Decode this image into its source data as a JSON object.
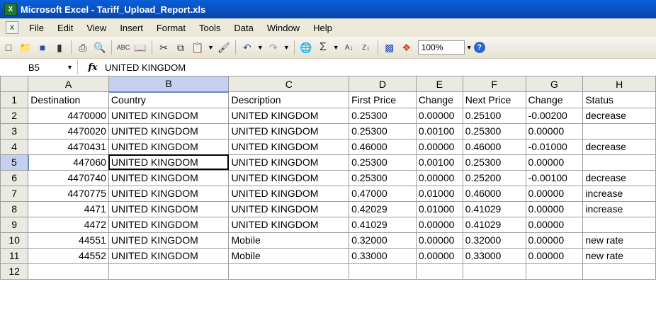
{
  "window": {
    "title": "Microsoft Excel - Tariff_Upload_Report.xls",
    "app_icon_text": "X",
    "doc_icon_text": "X"
  },
  "menu": [
    "File",
    "Edit",
    "View",
    "Insert",
    "Format",
    "Tools",
    "Data",
    "Window",
    "Help"
  ],
  "toolbar": {
    "icons": [
      "new-icon",
      "open-icon",
      "save-icon",
      "permission-icon",
      "print-icon",
      "print-preview-icon",
      "spelling-icon",
      "research-icon",
      "cut-icon",
      "copy-icon",
      "paste-icon",
      "format-painter-icon",
      "undo-icon",
      "redo-icon",
      "hyperlink-icon",
      "autosum-icon",
      "sort-ascending-icon",
      "sort-descending-icon",
      "chart-wizard-icon",
      "drawing-icon",
      "help-icon"
    ],
    "zoom": "100%",
    "help_glyph": "?"
  },
  "formula_bar": {
    "cell_ref": "B5",
    "fx": "fx",
    "value": "UNITED KINGDOM"
  },
  "grid": {
    "columns": [
      "A",
      "B",
      "C",
      "D",
      "E",
      "F",
      "G",
      "H"
    ],
    "selected_column": "B",
    "selected_row": "5",
    "rows": [
      {
        "n": "1",
        "cells": [
          "Destination",
          "Country",
          "Description",
          "First Price",
          "Change",
          "Next Price",
          "Change",
          "Status"
        ]
      },
      {
        "n": "2",
        "cells": [
          "4470000",
          "UNITED KINGDOM",
          "UNITED KINGDOM",
          "0.25300",
          "0.00000",
          "0.25100",
          "-0.00200",
          "decrease"
        ]
      },
      {
        "n": "3",
        "cells": [
          "4470020",
          "UNITED KINGDOM",
          "UNITED KINGDOM",
          "0.25300",
          "0.00100",
          "0.25300",
          "0.00000",
          ""
        ]
      },
      {
        "n": "4",
        "cells": [
          "4470431",
          "UNITED KINGDOM",
          "UNITED KINGDOM",
          "0.46000",
          "0.00000",
          "0.46000",
          "-0.01000",
          "decrease"
        ]
      },
      {
        "n": "5",
        "cells": [
          "447060",
          "UNITED KINGDOM",
          "UNITED KINGDOM",
          "0.25300",
          "0.00100",
          "0.25300",
          "0.00000",
          ""
        ]
      },
      {
        "n": "6",
        "cells": [
          "4470740",
          "UNITED KINGDOM",
          "UNITED KINGDOM",
          "0.25300",
          "0.00000",
          "0.25200",
          "-0.00100",
          "decrease"
        ]
      },
      {
        "n": "7",
        "cells": [
          "4470775",
          "UNITED KINGDOM",
          "UNITED KINGDOM",
          "0.47000",
          "0.01000",
          "0.46000",
          "0.00000",
          "increase"
        ]
      },
      {
        "n": "8",
        "cells": [
          "4471",
          "UNITED KINGDOM",
          "UNITED KINGDOM",
          "0.42029",
          "0.01000",
          "0.41029",
          "0.00000",
          "increase"
        ]
      },
      {
        "n": "9",
        "cells": [
          "4472",
          "UNITED KINGDOM",
          "UNITED KINGDOM",
          "0.41029",
          "0.00000",
          "0.41029",
          "0.00000",
          ""
        ]
      },
      {
        "n": "10",
        "cells": [
          "44551",
          "UNITED KINGDOM",
          "Mobile",
          "0.32000",
          "0.00000",
          "0.32000",
          "0.00000",
          "new rate"
        ]
      },
      {
        "n": "11",
        "cells": [
          "44552",
          "UNITED KINGDOM",
          "Mobile",
          "0.33000",
          "0.00000",
          "0.33000",
          "0.00000",
          "new rate"
        ]
      },
      {
        "n": "12",
        "cells": [
          "",
          "",
          "",
          "",
          "",
          "",
          "",
          ""
        ]
      }
    ]
  }
}
